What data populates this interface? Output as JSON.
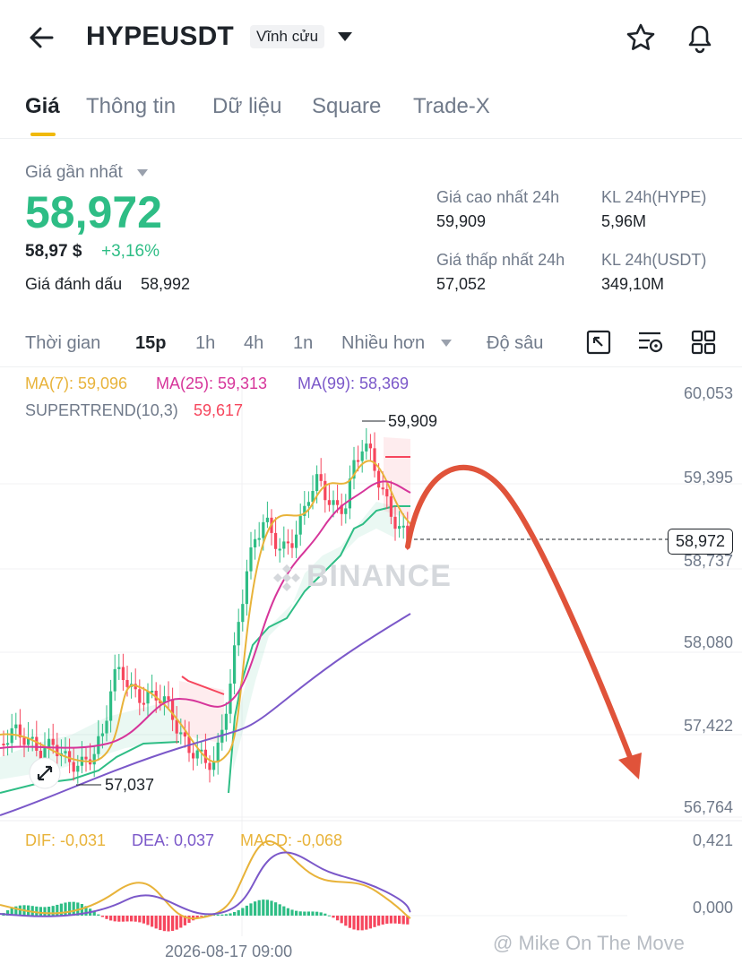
{
  "header": {
    "symbol": "HYPEUSDT",
    "contract_type": "Vĩnh cửu"
  },
  "tabs": [
    "Giá",
    "Thông tin",
    "Dữ liệu",
    "Square",
    "Trade-X"
  ],
  "price": {
    "label": "Giá gần nhất",
    "last": "58,972",
    "usd": "58,97 $",
    "change": "+3,16%",
    "mark_label": "Giá đánh dấu",
    "mark_value": "58,992"
  },
  "stats": {
    "high_label": "Giá cao nhất 24h",
    "high_value": "59,909",
    "low_label": "Giá thấp nhất 24h",
    "low_value": "57,052",
    "vol_base_label": "KL 24h(HYPE)",
    "vol_base_value": "5,96M",
    "vol_quote_label": "KL 24h(USDT)",
    "vol_quote_value": "349,10M"
  },
  "timeframes": {
    "label": "Thời gian",
    "items": [
      "15p",
      "1h",
      "4h",
      "1n"
    ],
    "more": "Nhiều hơn",
    "depth": "Độ sâu"
  },
  "indicators": {
    "ma7": "MA(7): 59,096",
    "ma25": "MA(25): 59,313",
    "ma99": "MA(99): 58,369",
    "supertrend_label": "SUPERTREND(10,3)",
    "supertrend_value": "59,617"
  },
  "price_axis": [
    "60,053",
    "59,395",
    "58,737",
    "58,080",
    "57,422",
    "56,764"
  ],
  "current_price_tag": "58,972",
  "high_marker": "59,909",
  "low_marker": "57,037",
  "watermark": "BINANCE",
  "macd": {
    "dif": "DIF: -0,031",
    "dea": "DEA: 0,037",
    "macd": "MACD: -0,068",
    "axis_top": "0,421",
    "axis_zero": "0,000"
  },
  "time_label": "2026-08-17 09:00",
  "credit": "@ Mike On The Move",
  "colors": {
    "up": "#2ebd85",
    "down": "#f6465d",
    "ma7": "#e8b33a",
    "ma25": "#d6359a",
    "ma99": "#7b58c9",
    "accent": "#f0b90b",
    "arrow": "#e0533a"
  }
}
